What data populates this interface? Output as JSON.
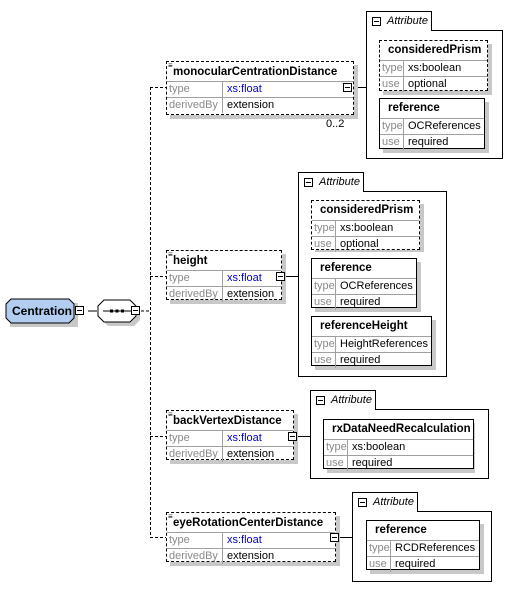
{
  "root": {
    "name": "Centration"
  },
  "sequence": {
    "icon": "sequence-icon"
  },
  "elements": [
    {
      "name": "monocularCentrationDistance",
      "rows": [
        {
          "key": "type",
          "value": "xs:float"
        },
        {
          "key": "derivedBy",
          "value": "extension"
        }
      ],
      "multiplicity": "0..2",
      "attribute_group": {
        "label": "Attribute",
        "attributes": [
          {
            "name": "consideredPrism",
            "optional": true,
            "rows": [
              {
                "key": "type",
                "value": "xs:boolean"
              },
              {
                "key": "use",
                "value": "optional"
              }
            ]
          },
          {
            "name": "reference",
            "optional": false,
            "rows": [
              {
                "key": "type",
                "value": "OCReferences"
              },
              {
                "key": "use",
                "value": "required"
              }
            ]
          }
        ]
      }
    },
    {
      "name": "height",
      "rows": [
        {
          "key": "type",
          "value": "xs:float"
        },
        {
          "key": "derivedBy",
          "value": "extension"
        }
      ],
      "attribute_group": {
        "label": "Attribute",
        "attributes": [
          {
            "name": "consideredPrism",
            "optional": true,
            "rows": [
              {
                "key": "type",
                "value": "xs:boolean"
              },
              {
                "key": "use",
                "value": "optional"
              }
            ]
          },
          {
            "name": "reference",
            "optional": false,
            "rows": [
              {
                "key": "type",
                "value": "OCReferences"
              },
              {
                "key": "use",
                "value": "required"
              }
            ]
          },
          {
            "name": "referenceHeight",
            "optional": false,
            "rows": [
              {
                "key": "type",
                "value": "HeightReferences"
              },
              {
                "key": "use",
                "value": "required"
              }
            ]
          }
        ]
      }
    },
    {
      "name": "backVertexDistance",
      "rows": [
        {
          "key": "type",
          "value": "xs:float"
        },
        {
          "key": "derivedBy",
          "value": "extension"
        }
      ],
      "attribute_group": {
        "label": "Attribute",
        "attributes": [
          {
            "name": "rxDataNeedRecalculation",
            "optional": false,
            "rows": [
              {
                "key": "type",
                "value": "xs:boolean"
              },
              {
                "key": "use",
                "value": "required"
              }
            ]
          }
        ]
      }
    },
    {
      "name": "eyeRotationCenterDistance",
      "rows": [
        {
          "key": "type",
          "value": "xs:float"
        },
        {
          "key": "derivedBy",
          "value": "extension"
        }
      ],
      "attribute_group": {
        "label": "Attribute",
        "attributes": [
          {
            "name": "reference",
            "optional": false,
            "rows": [
              {
                "key": "type",
                "value": "RCDReferences"
              },
              {
                "key": "use",
                "value": "required"
              }
            ]
          }
        ]
      }
    }
  ],
  "colors": {
    "root_fill": "#b3cdf1",
    "type_value": "#0000cc",
    "label_gray": "#8a8a8a",
    "shadow": "#c8c8c8"
  }
}
